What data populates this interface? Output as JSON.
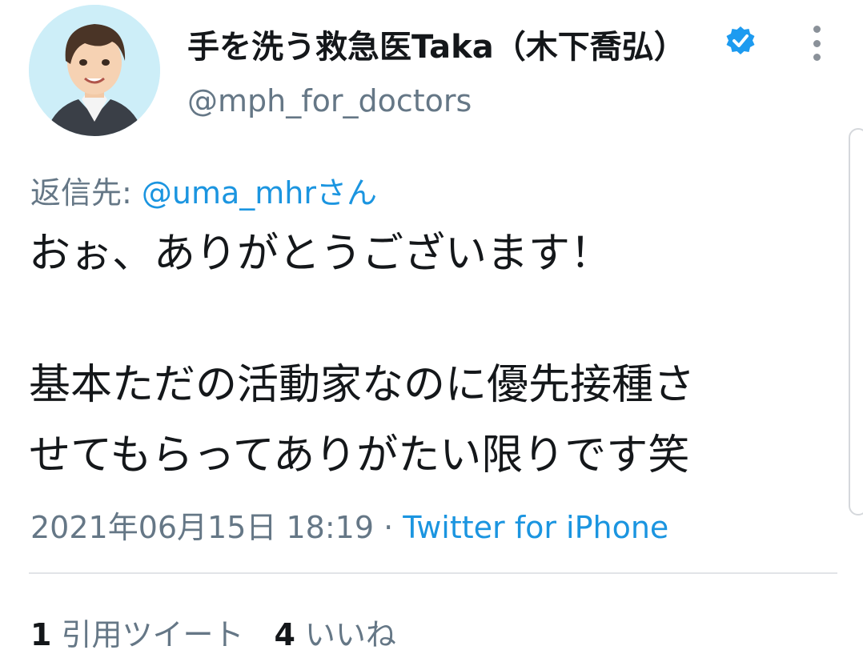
{
  "author": {
    "display_name": "手を洗う救急医Taka（木下喬弘）",
    "handle": "@mph_for_doctors",
    "verified": true,
    "avatar_icon": "user-avatar-illustration"
  },
  "reply": {
    "prefix": "返信先: ",
    "mention": "@uma_mhr",
    "suffix": "さん"
  },
  "tweet": {
    "lines": [
      "おぉ、ありがとうございます！",
      "基本ただの活動家なのに優先接種さ",
      "せてもらってありがたい限りです笑"
    ]
  },
  "meta": {
    "timestamp": "2021年06月15日 18:19",
    "separator": " · ",
    "source": "Twitter for iPhone"
  },
  "stats": {
    "quote_count": "1",
    "quote_label": "引用ツイート",
    "like_count": "4",
    "like_label": "いいね"
  },
  "colors": {
    "link": "#1b95e0",
    "muted": "#657786",
    "verified": "#1d9bf0"
  }
}
